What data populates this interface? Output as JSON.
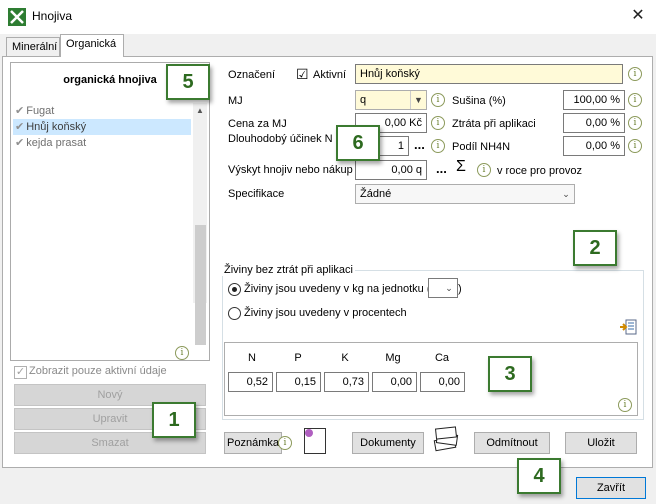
{
  "window": {
    "title": "Hnojiva",
    "close_glyph": "✕"
  },
  "tabs": [
    {
      "label": "Minerální"
    },
    {
      "label": "Organická"
    }
  ],
  "list": {
    "header": "organická hnojiva",
    "items": [
      "Fugat",
      "Hnůj koňský",
      "kejda prasat"
    ],
    "selected": "Hnůj koňský",
    "check_glyph": "✔",
    "show_active_label": "Zobrazit pouze aktivní údaje"
  },
  "left_buttons": {
    "new": "Nový",
    "edit": "Upravit",
    "delete": "Smazat"
  },
  "form": {
    "oznaceni_label": "Označení",
    "aktivni_label": "Aktivní",
    "aktivni_checked": "☑",
    "oznaceni_value": "Hnůj koňský",
    "mj_label": "MJ",
    "mj_value": "q",
    "cena_label": "Cena za MJ",
    "cena_value": "0,00 Kč",
    "ucinek_label": "Dlouhodobý účinek N (",
    "ucinek_value": "1",
    "ellipsis": "...",
    "vyskyt_label": "Výskyt hnojiv nebo nákup",
    "vyskyt_value": "0,00 q",
    "sum_glyph": "Σ",
    "v_roce_label": "v roce pro provoz",
    "specifikace_label": "Specifikace",
    "specifikace_value": "Žádné",
    "susina_label": "Sušina (%)",
    "susina_value": "100,00 %",
    "ztrata_label": "Ztráta při aplikaci",
    "ztrata_value": "0,00 %",
    "nh4n_label": "Podíl NH4N",
    "nh4n_value": "0,00 %"
  },
  "nutrients": {
    "group_label": "Živiny bez ztrát při aplikaci",
    "radio_kg_label": "Živiny jsou uvedeny v kg na jednotku (",
    "radio_kg_close": ")",
    "radio_pct_label": "Živiny jsou uvedeny v procentech",
    "headers": [
      "N",
      "P",
      "K",
      "Mg",
      "Ca"
    ],
    "values": [
      "0,52",
      "0,15",
      "0,73",
      "0,00",
      "0,00"
    ]
  },
  "bottom_buttons": {
    "poznamka": "Poznámka",
    "dokumenty": "Dokumenty",
    "odmitnout": "Odmítnout",
    "ulozit": "Uložit",
    "zavrit": "Zavřít"
  },
  "info_glyph": "i",
  "callouts": [
    "1",
    "2",
    "3",
    "4",
    "5",
    "6"
  ],
  "colors": {
    "accent_green": "#3b7a30",
    "input_yellow": "#fffad8",
    "selection": "#cce8ff"
  }
}
